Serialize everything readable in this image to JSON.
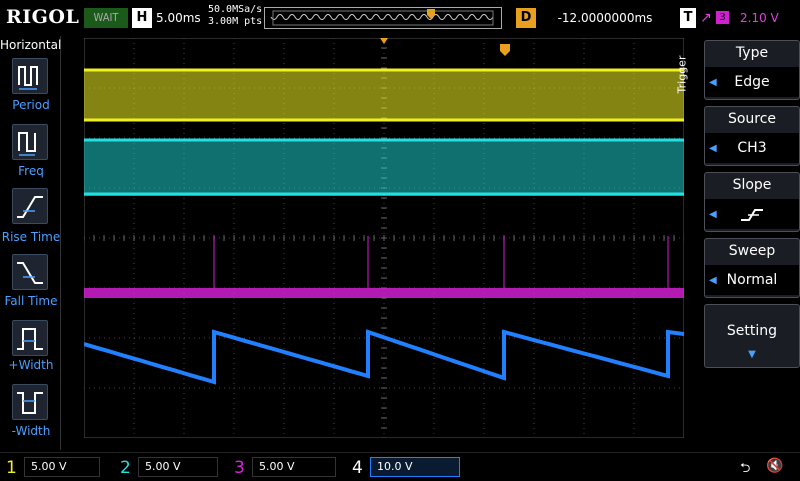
{
  "top": {
    "brand": "RIGOL",
    "run_state": "WAIT",
    "horizontal_label": "H",
    "timebase": "5.00ms",
    "sample_rate": "50.0MSa/s",
    "memory_depth": "3.00M pts",
    "delay_label": "D",
    "delay": "-12.0000000ms",
    "trigger_label": "T",
    "trigger_source_num": "3",
    "trigger_level": "2.10 V"
  },
  "left": {
    "title": "Horizontal",
    "items": [
      "Period",
      "Freq",
      "Rise Time",
      "Fall Time",
      "+Width",
      "-Width"
    ]
  },
  "right": {
    "section": "Trigger",
    "menus": [
      {
        "title": "Type",
        "value": "Edge"
      },
      {
        "title": "Source",
        "value": "CH3"
      },
      {
        "title": "Slope",
        "value": ""
      },
      {
        "title": "Sweep",
        "value": "Normal"
      },
      {
        "title": "Setting",
        "value": ""
      }
    ]
  },
  "channels": [
    {
      "num": "1",
      "scale": "5.00 V",
      "color": "#f0f020"
    },
    {
      "num": "2",
      "scale": "5.00 V",
      "color": "#20e0e0"
    },
    {
      "num": "3",
      "scale": "5.00 V",
      "color": "#e020e0"
    },
    {
      "num": "4",
      "scale": "10.0 V",
      "color": "#2080ff"
    }
  ],
  "colors": {
    "ch1": "#f0f020",
    "ch2": "#20e0e0",
    "ch3": "#e020e0",
    "ch4": "#2080ff",
    "accent": "#e8a020"
  },
  "icons": [
    "usb-icon",
    "speaker-muted-icon"
  ]
}
